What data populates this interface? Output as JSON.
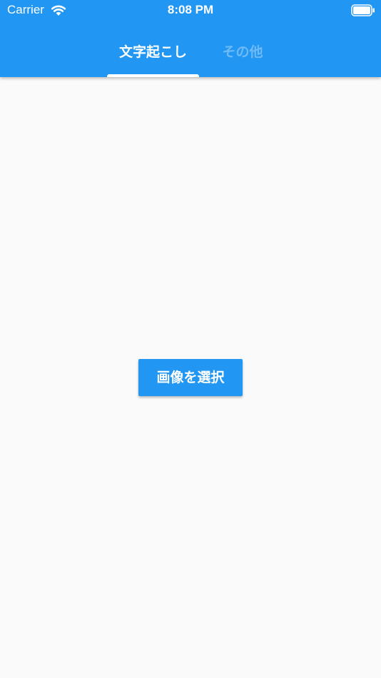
{
  "status_bar": {
    "carrier": "Carrier",
    "time": "8:08 PM",
    "wifi_icon": "wifi-icon",
    "battery_icon": "battery-full-icon"
  },
  "tabs": [
    {
      "label": "文字起こし",
      "selected": true
    },
    {
      "label": "その他",
      "selected": false
    }
  ],
  "main": {
    "select_image_button": "画像を選択"
  },
  "colors": {
    "primary": "#2196f3",
    "background": "#fafafa",
    "on_primary": "#ffffff"
  }
}
